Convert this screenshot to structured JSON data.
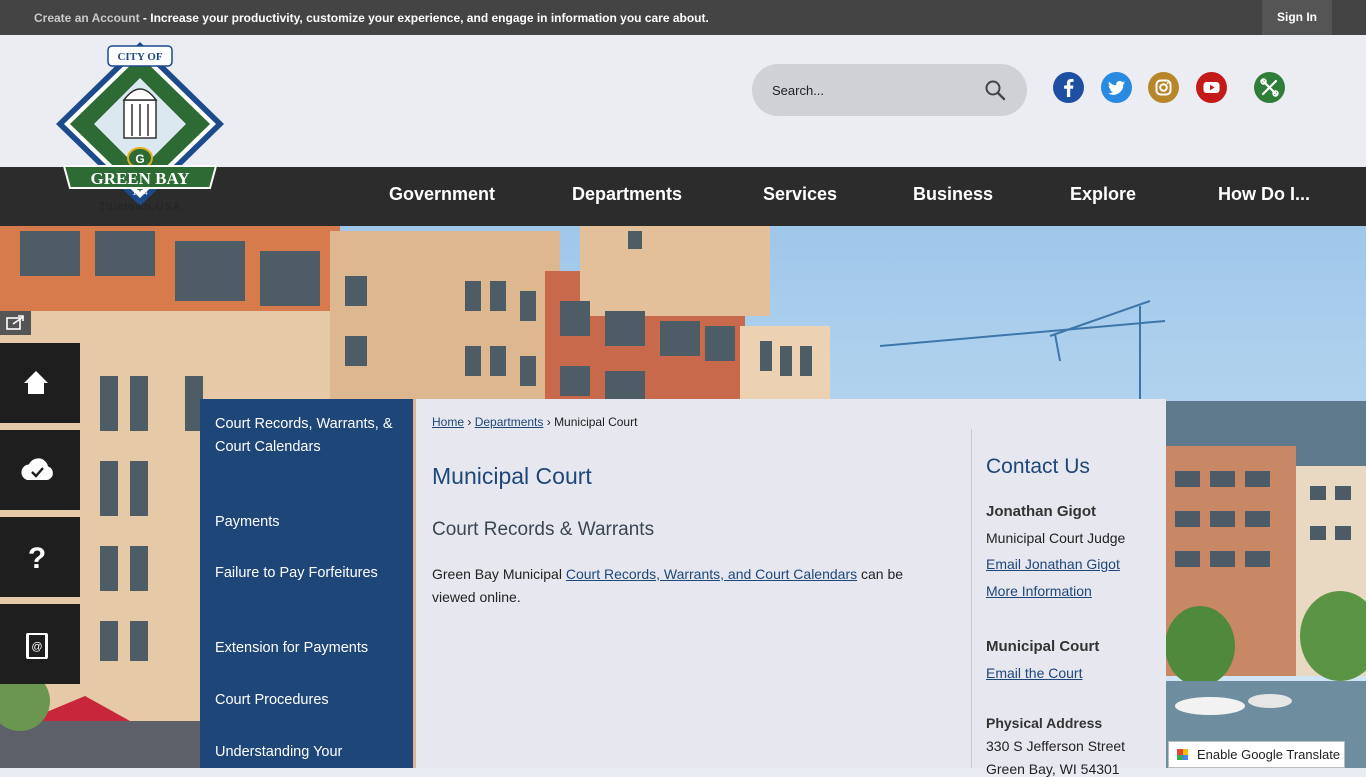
{
  "topbar": {
    "create_account": "Create an Account",
    "tagline": " - Increase your productivity, customize your experience, and engage in information you care about.",
    "sign_in": "Sign In"
  },
  "header": {
    "search_placeholder": "Search...",
    "social": [
      "facebook-icon",
      "twitter-icon",
      "instagram-icon",
      "youtube-icon",
      "tools-icon"
    ],
    "logo": {
      "top_text": "CITY OF",
      "name": "GREEN BAY",
      "year": "1854",
      "tagline": "Titletown,USA"
    }
  },
  "nav": {
    "items": [
      "Government",
      "Departments",
      "Services",
      "Business",
      "Explore",
      "How Do I..."
    ]
  },
  "left_tools": [
    "home-icon",
    "cloud-check-icon",
    "question-icon",
    "contact-book-icon"
  ],
  "sidenav": {
    "items": [
      "Court Records, Warrants, & Court Calendars",
      "Payments",
      "Failure to Pay Forfeitures",
      "Extension for Payments",
      "Court Procedures",
      "Understanding Your"
    ]
  },
  "content": {
    "breadcrumb": {
      "home": "Home",
      "sep1": " › ",
      "departments": "Departments",
      "sep2": " › ",
      "current": "Municipal Court"
    },
    "title": "Municipal Court",
    "subtitle": "Court Records & Warrants",
    "para_pre": "Green Bay Municipal ",
    "para_link": "Court Records, Warrants, and Court Calendars",
    "para_post": " can be viewed online."
  },
  "contact": {
    "heading": "Contact Us",
    "person_name": "Jonathan Gigot",
    "person_title": "Municipal Court Judge",
    "email_person": "Email Jonathan Gigot",
    "more_info": "More Information",
    "dept_name": "Municipal Court",
    "email_court": "Email the Court",
    "address_label": "Physical Address",
    "address_line1": "330 S Jefferson Street",
    "address_line2": "Green Bay, WI 54301"
  },
  "translate": {
    "label": "Enable Google Translate"
  },
  "colors": {
    "navy": "#1f4678",
    "topbar": "#444444",
    "nav": "#2c2c2c",
    "header": "#ecedf3"
  }
}
